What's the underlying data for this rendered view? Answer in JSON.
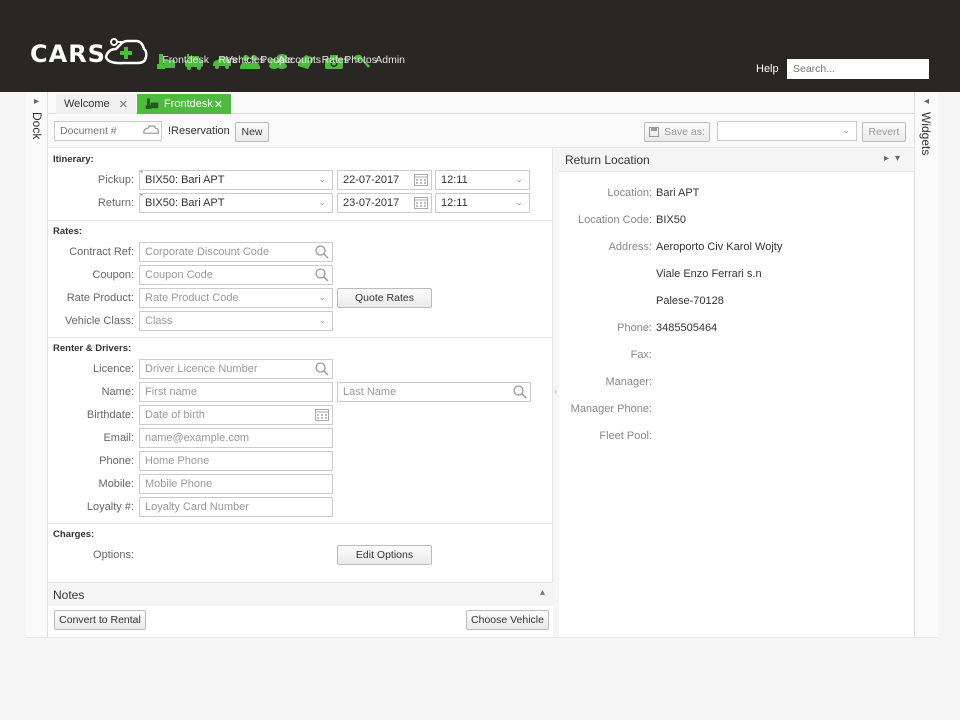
{
  "brand": {
    "logo_text": "CARS"
  },
  "nav": [
    {
      "label": "Frontdesk",
      "icon": "frontdesk-icon"
    },
    {
      "label": "Res",
      "icon": "reservation-icon"
    },
    {
      "label": "Vehicles",
      "icon": "car-icon"
    },
    {
      "label": "People",
      "icon": "people-icon"
    },
    {
      "label": "Accounts",
      "icon": "coins-icon"
    },
    {
      "label": "Rates",
      "icon": "rates-icon"
    },
    {
      "label": "Photos",
      "icon": "camera-icon"
    },
    {
      "label": "Admin",
      "icon": "wrench-icon"
    }
  ],
  "header": {
    "help": "Help",
    "search_placeholder": "Search..."
  },
  "colors": {
    "accent": "#4cbb3f",
    "topbar": "#2a2624"
  },
  "docks": {
    "left": "Dock",
    "right": "Widgets"
  },
  "tabs": [
    {
      "label": "Welcome",
      "active": false
    },
    {
      "label": "Frontdesk",
      "active": true
    }
  ],
  "toolbar": {
    "document_placeholder": "Document #",
    "reservation_label": "!Reservation",
    "new_label": "New",
    "save_as_label": "Save as:",
    "revert_label": "Revert"
  },
  "itinerary": {
    "title": "Itinerary:",
    "pickup": {
      "label": "Pickup:",
      "location": "BIX50: Bari APT",
      "date": "22-07-2017",
      "time": "12:11"
    },
    "return": {
      "label": "Return:",
      "location": "BIX50: Bari APT",
      "date": "23-07-2017",
      "time": "12:11"
    }
  },
  "rates": {
    "title": "Rates:",
    "contract_ref": {
      "label": "Contract Ref:",
      "placeholder": "Corporate Discount Code"
    },
    "coupon": {
      "label": "Coupon:",
      "placeholder": "Coupon Code"
    },
    "rate_product": {
      "label": "Rate Product:",
      "placeholder": "Rate Product Code"
    },
    "vehicle_class": {
      "label": "Vehicle Class:",
      "placeholder": "Class"
    },
    "quote_button": "Quote Rates"
  },
  "renter": {
    "title": "Renter & Drivers:",
    "licence": {
      "label": "Licence:",
      "placeholder": "Driver Licence Number"
    },
    "name": {
      "label": "Name:",
      "first_placeholder": "First name",
      "last_placeholder": "Last Name"
    },
    "birthdate": {
      "label": "Birthdate:",
      "placeholder": "Date of birth"
    },
    "email": {
      "label": "Email:",
      "placeholder": "name@example.com"
    },
    "phone": {
      "label": "Phone:",
      "placeholder": "Home Phone"
    },
    "mobile": {
      "label": "Mobile:",
      "placeholder": "Mobile Phone"
    },
    "loyalty": {
      "label": "Loyalty #:",
      "placeholder": "Loyalty Card Number"
    }
  },
  "charges": {
    "title": "Charges:",
    "options_label": "Options:",
    "edit_button": "Edit Options"
  },
  "notes": {
    "title": "Notes"
  },
  "actions": {
    "convert": "Convert to Rental",
    "choose_vehicle": "Choose Vehicle"
  },
  "return_location": {
    "title": "Return Location",
    "location_label": "Location:",
    "location": "Bari APT",
    "code_label": "Location Code:",
    "code": "BIX50",
    "address_label": "Address:",
    "address_1": "Aeroporto Civ Karol Wojty",
    "address_2": "Viale Enzo Ferrari s.n",
    "address_3": "Palese-70128",
    "phone_label": "Phone:",
    "phone": "3485505464",
    "fax_label": "Fax:",
    "manager_label": "Manager:",
    "manager_phone_label": "Manager Phone:",
    "fleet_pool_label": "Fleet Pool:"
  }
}
